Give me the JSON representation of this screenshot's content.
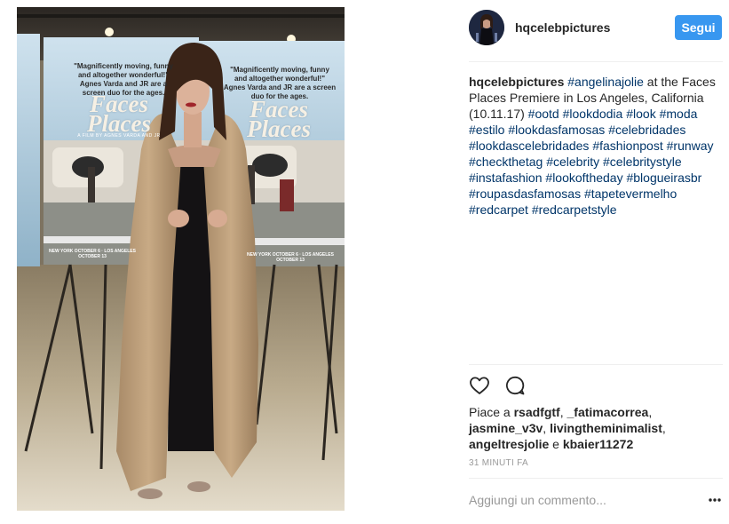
{
  "photo": {
    "alt": "",
    "poster_quote": "\"Magnificently moving, funny and altogether wonderful!\" Agnes Varda and JR are a screen duo for the ages.",
    "poster_title_1": "Faces",
    "poster_title_2": "Places",
    "poster_by": "A FILM BY AGNES VARDA AND JR",
    "poster_bottom": "NEW YORK OCTOBER 6 · LOS ANGELES OCTOBER 13"
  },
  "header": {
    "username": "hqcelebpictures",
    "follow_label": "Segui"
  },
  "caption": {
    "username": "hqcelebpictures",
    "segments": [
      {
        "type": "tag",
        "text": "#angelinajolie"
      },
      {
        "type": "text",
        "text": " at the Faces Places Premiere in Los Angeles, California (10.11.17) "
      },
      {
        "type": "tag",
        "text": "#ootd"
      },
      {
        "type": "text",
        "text": " "
      },
      {
        "type": "tag",
        "text": "#lookdodia"
      },
      {
        "type": "text",
        "text": " "
      },
      {
        "type": "tag",
        "text": "#look"
      },
      {
        "type": "text",
        "text": " "
      },
      {
        "type": "tag",
        "text": "#moda"
      },
      {
        "type": "text",
        "text": " "
      },
      {
        "type": "tag",
        "text": "#estilo"
      },
      {
        "type": "text",
        "text": " "
      },
      {
        "type": "tag",
        "text": "#lookdasfamosas"
      },
      {
        "type": "text",
        "text": " "
      },
      {
        "type": "tag",
        "text": "#celebridades"
      },
      {
        "type": "text",
        "text": " "
      },
      {
        "type": "tag",
        "text": "#lookdascelebridades"
      },
      {
        "type": "text",
        "text": " "
      },
      {
        "type": "tag",
        "text": "#fashionpost"
      },
      {
        "type": "text",
        "text": " "
      },
      {
        "type": "tag",
        "text": "#runway"
      },
      {
        "type": "text",
        "text": " "
      },
      {
        "type": "tag",
        "text": "#checkthetag"
      },
      {
        "type": "text",
        "text": " "
      },
      {
        "type": "tag",
        "text": "#celebrity"
      },
      {
        "type": "text",
        "text": " "
      },
      {
        "type": "tag",
        "text": "#celebritystyle"
      },
      {
        "type": "text",
        "text": " "
      },
      {
        "type": "tag",
        "text": "#instafashion"
      },
      {
        "type": "text",
        "text": " "
      },
      {
        "type": "tag",
        "text": "#lookoftheday"
      },
      {
        "type": "text",
        "text": " "
      },
      {
        "type": "tag",
        "text": "#blogueirasbr"
      },
      {
        "type": "text",
        "text": " "
      },
      {
        "type": "tag",
        "text": "#roupasdasfamosas"
      },
      {
        "type": "text",
        "text": " "
      },
      {
        "type": "tag",
        "text": "#tapetevermelho"
      },
      {
        "type": "text",
        "text": " "
      },
      {
        "type": "tag",
        "text": "#redcarpet"
      },
      {
        "type": "text",
        "text": " "
      },
      {
        "type": "tag",
        "text": "#redcarpetstyle"
      }
    ]
  },
  "actions": {
    "like_icon": "heart-outline-icon",
    "comment_icon": "speech-bubble-icon"
  },
  "likes": {
    "prefix": "Piace a ",
    "users": [
      "rsadfgtf",
      "_fatimacorrea",
      "jasmine_v3v",
      "livingtheminimalist",
      "angeltresjolie"
    ],
    "conjunction": " e ",
    "last_user": "kbaier11272"
  },
  "timestamp": "31 MINUTI FA",
  "comment": {
    "placeholder": "Aggiungi un commento...",
    "more_icon": "ellipsis-icon"
  }
}
